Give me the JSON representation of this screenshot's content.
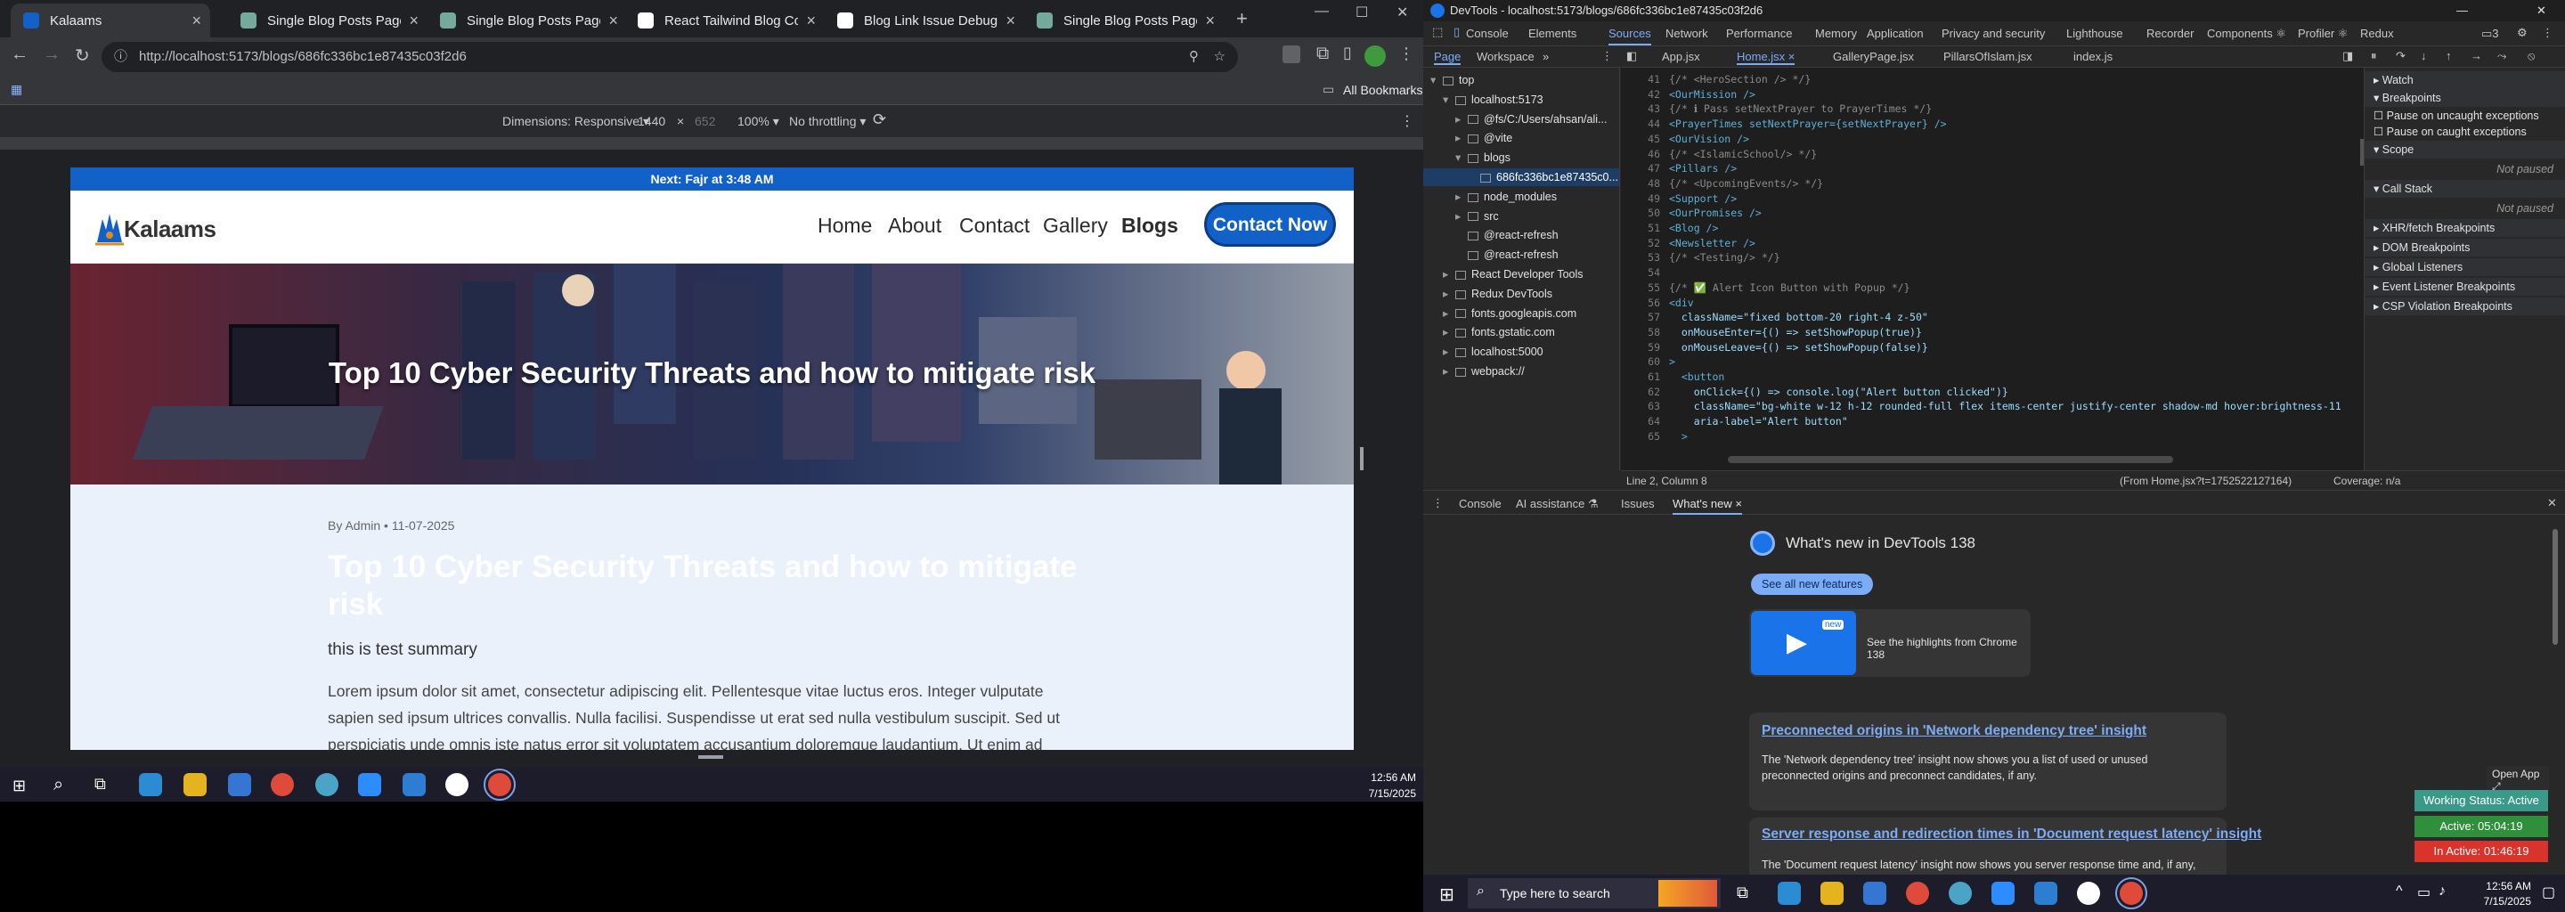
{
  "browser": {
    "tabs": [
      {
        "title": "Kalaams",
        "active": true,
        "color": "#1261c9"
      },
      {
        "title": "Single Blog Posts Page Desig",
        "active": false,
        "color": "#74aa9c"
      },
      {
        "title": "Single Blog Posts Page Desig",
        "active": false,
        "color": "#74aa9c"
      },
      {
        "title": "React Tailwind Blog Convers",
        "active": false,
        "color": "#ffffff"
      },
      {
        "title": "Blog Link Issue Debugging",
        "active": false,
        "color": "#ffffff"
      },
      {
        "title": "Single Blog Posts Page Desig",
        "active": false,
        "color": "#74aa9c"
      }
    ],
    "new_tab": "+",
    "url": "http://localhost:5173/blogs/686fc336bc1e87435c03f2d6",
    "bookmarks_label": "All Bookmarks",
    "device_toolbar": {
      "dimensions_label": "Dimensions: Responsive ▾",
      "width": "1440",
      "times": "×",
      "height": "652",
      "zoom": "100% ▾",
      "throttle": "No throttling ▾"
    }
  },
  "site": {
    "announcement": "Next: Fajr at 3:48 AM",
    "logo_text": "Kalaams",
    "nav": [
      "Home",
      "About",
      "Contact",
      "Gallery",
      "Blogs"
    ],
    "cta": "Contact Now",
    "hero_title": "Top 10 Cyber Security Threats and how to mitigate risk",
    "meta": "By Admin • 11-07-2025",
    "post_title": "Top 10 Cyber Security Threats and how to mitigate risk",
    "summary": "this is test summary",
    "body_lines": [
      "Lorem ipsum dolor sit amet, consectetur adipiscing elit. Pellentesque vitae luctus eros. Integer vulputate",
      "sapien sed ipsum ultrices convallis. Nulla facilisi. Suspendisse ut erat sed nulla vestibulum suscipit. Sed ut",
      "perspiciatis unde omnis iste natus error sit voluptatem accusantium doloremque laudantium. Ut enim ad"
    ]
  },
  "taskbar_left": {
    "time": "12:56 AM",
    "date": "7/15/2025"
  },
  "devtools": {
    "title": "DevTools - localhost:5173/blogs/686fc336bc1e87435c03f2d6",
    "panels": [
      "Console",
      "Elements",
      "Sources",
      "Network",
      "Performance",
      "Memory",
      "Application",
      "Privacy and security",
      "Lighthouse",
      "Recorder",
      "Components ⚛",
      "Profiler ⚛",
      "Redux"
    ],
    "active_panel": "Sources",
    "nav_tabs": [
      "Page",
      "Workspace",
      "»"
    ],
    "file_tabs": [
      "App.jsx",
      "Home.jsx ×",
      "GalleryPage.jsx",
      "PillarsOfIslam.jsx",
      "index.js"
    ],
    "tree": [
      {
        "label": "top",
        "indent": 0,
        "arrow": "▾"
      },
      {
        "label": "localhost:5173",
        "indent": 1,
        "arrow": "▾"
      },
      {
        "label": "@fs/C:/Users/ahsan/ali...",
        "indent": 2,
        "arrow": "▸"
      },
      {
        "label": "@vite",
        "indent": 2,
        "arrow": "▸"
      },
      {
        "label": "blogs",
        "indent": 2,
        "arrow": "▾"
      },
      {
        "label": "686fc336bc1e87435c0...",
        "indent": 3,
        "arrow": "",
        "selected": true
      },
      {
        "label": "node_modules",
        "indent": 2,
        "arrow": "▸"
      },
      {
        "label": "src",
        "indent": 2,
        "arrow": "▸"
      },
      {
        "label": "@react-refresh",
        "indent": 2,
        "arrow": ""
      },
      {
        "label": "@react-refresh",
        "indent": 2,
        "arrow": ""
      },
      {
        "label": "React Developer Tools",
        "indent": 1,
        "arrow": "▸"
      },
      {
        "label": "Redux DevTools",
        "indent": 1,
        "arrow": "▸"
      },
      {
        "label": "fonts.googleapis.com",
        "indent": 1,
        "arrow": "▸"
      },
      {
        "label": "fonts.gstatic.com",
        "indent": 1,
        "arrow": "▸"
      },
      {
        "label": "localhost:5000",
        "indent": 1,
        "arrow": "▸"
      },
      {
        "label": "webpack://",
        "indent": 1,
        "arrow": "▸"
      }
    ],
    "code_lines": [
      {
        "n": "41",
        "t": "{/* <HeroSection /> */}",
        "k": "cm"
      },
      {
        "n": "42",
        "t": "<OurMission />",
        "k": "tag"
      },
      {
        "n": "43",
        "t": "{/* ℹ Pass setNextPrayer to PrayerTimes */}",
        "k": "cm"
      },
      {
        "n": "44",
        "t": "<PrayerTimes setNextPrayer={setNextPrayer} />",
        "k": "tag"
      },
      {
        "n": "45",
        "t": "<OurVision />",
        "k": "tag"
      },
      {
        "n": "46",
        "t": "{/* <IslamicSchool/> */}",
        "k": "cm"
      },
      {
        "n": "47",
        "t": "<Pillars />",
        "k": "tag"
      },
      {
        "n": "48",
        "t": "{/* <UpcomingEvents/> */}",
        "k": "cm"
      },
      {
        "n": "49",
        "t": "<Support />",
        "k": "tag"
      },
      {
        "n": "50",
        "t": "<OurPromises />",
        "k": "tag"
      },
      {
        "n": "51",
        "t": "<Blog />",
        "k": "tag"
      },
      {
        "n": "52",
        "t": "<Newsletter />",
        "k": "tag"
      },
      {
        "n": "53",
        "t": "{/* <Testing/> */}",
        "k": "cm"
      },
      {
        "n": "54",
        "t": "",
        "k": "cm"
      },
      {
        "n": "55",
        "t": "{/* ✅ Alert Icon Button with Popup */}",
        "k": "cm"
      },
      {
        "n": "56",
        "t": "<div",
        "k": "tag"
      },
      {
        "n": "57",
        "t": "  className=\"fixed bottom-20 right-4 z-50\"",
        "k": "at"
      },
      {
        "n": "58",
        "t": "  onMouseEnter={() => setShowPopup(true)}",
        "k": "at"
      },
      {
        "n": "59",
        "t": "  onMouseLeave={() => setShowPopup(false)}",
        "k": "at"
      },
      {
        "n": "60",
        "t": ">",
        "k": "tag"
      },
      {
        "n": "61",
        "t": "  <button",
        "k": "tag"
      },
      {
        "n": "62",
        "t": "    onClick={() => console.log(\"Alert button clicked\")}",
        "k": "at"
      },
      {
        "n": "63",
        "t": "    className=\"bg-white w-12 h-12 rounded-full flex items-center justify-center shadow-md hover:brightness-11",
        "k": "at"
      },
      {
        "n": "64",
        "t": "    aria-label=\"Alert button\"",
        "k": "at"
      },
      {
        "n": "65",
        "t": "  >",
        "k": "tag"
      }
    ],
    "status_left": "Line 2, Column 8",
    "status_from": "(From Home.jsx?t=1752522127164)",
    "status_coverage": "Coverage: n/a",
    "debugger": [
      {
        "label": "▸ Watch",
        "hdr": true
      },
      {
        "label": "▾ Breakpoints",
        "hdr": true
      },
      {
        "label": "☐ Pause on uncaught exceptions"
      },
      {
        "label": "☐ Pause on caught exceptions"
      },
      {
        "label": "▾ Scope",
        "hdr": true
      },
      {
        "label": "Not paused",
        "muted": true
      },
      {
        "label": "▾ Call Stack",
        "hdr": true
      },
      {
        "label": "Not paused",
        "muted": true
      },
      {
        "label": "▸ XHR/fetch Breakpoints",
        "hdr": true
      },
      {
        "label": "▸ DOM Breakpoints",
        "hdr": true
      },
      {
        "label": "▸ Global Listeners",
        "hdr": true
      },
      {
        "label": "▸ Event Listener Breakpoints",
        "hdr": true
      },
      {
        "label": "▸ CSP Violation Breakpoints",
        "hdr": true
      }
    ],
    "drawer_tabs": [
      "Console",
      "AI assistance ⚗",
      "Issues",
      "What's new ×"
    ],
    "whats_new": {
      "title": "What's new in DevTools 138",
      "see_all": "See all new features",
      "video_caption": "See the highlights from Chrome 138",
      "video_badge": "new",
      "items": [
        {
          "title": "Preconnected origins in 'Network dependency tree' insight",
          "desc": "The 'Network dependency tree' insight now shows you a list of used or unused preconnected origins and preconnect candidates, if any."
        },
        {
          "title": "Server response and redirection times in 'Document request latency' insight",
          "desc": "The 'Document request latency' insight now shows you server response time and, if any,"
        }
      ]
    },
    "overlay": {
      "open_app": "Open App ⤢",
      "working_status": "Working Status: Active",
      "active": "Active: 05:04:19",
      "inactive": "In Active: 01:46:19"
    }
  },
  "taskbar_right": {
    "search_placeholder": "Type here to search",
    "time": "12:56 AM",
    "date": "7/15/2025"
  }
}
